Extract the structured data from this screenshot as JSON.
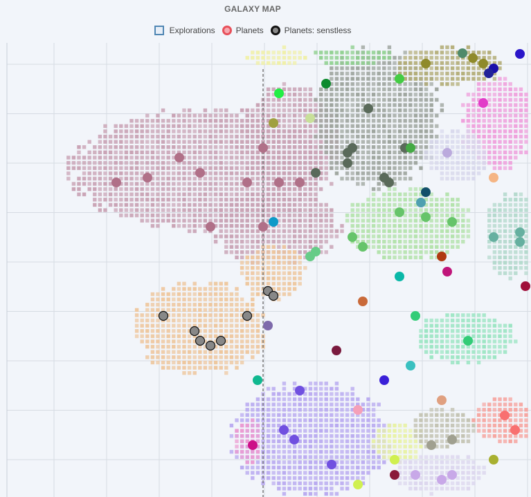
{
  "chart_data": {
    "type": "scatter",
    "title": "GALAXY MAP",
    "xlabel": "",
    "ylabel": "",
    "grid": true,
    "legend_position": "top",
    "series": [
      {
        "name": "Explorations",
        "kind": "square-grid",
        "color": "#4f86b3"
      },
      {
        "name": "Planets",
        "kind": "dot",
        "color": "#e8505a"
      },
      {
        "name": "Planets: senstless",
        "kind": "outlined-dot",
        "color": "#888888"
      }
    ],
    "regions": [
      {
        "color": "#c9a3b5",
        "center": [
          290,
          245
        ],
        "rx": 195,
        "ry": 90
      },
      {
        "color": "#c9a3b5",
        "center": [
          420,
          200
        ],
        "rx": 75,
        "ry": 80
      },
      {
        "color": "#c9a3b5",
        "center": [
          400,
          330
        ],
        "rx": 95,
        "ry": 55
      },
      {
        "color": "#9ea59e",
        "center": [
          545,
          170
        ],
        "rx": 95,
        "ry": 105
      },
      {
        "color": "#b3ad77",
        "center": [
          650,
          95
        ],
        "rx": 85,
        "ry": 30
      },
      {
        "color": "#efa0dc",
        "center": [
          718,
          180
        ],
        "rx": 55,
        "ry": 70
      },
      {
        "color": "#f0f0a8",
        "center": [
          400,
          82
        ],
        "rx": 50,
        "ry": 14
      },
      {
        "color": "#8fd08f",
        "center": [
          510,
          82
        ],
        "rx": 60,
        "ry": 14
      },
      {
        "color": "#d8d8ec",
        "center": [
          660,
          225
        ],
        "rx": 45,
        "ry": 40
      },
      {
        "color": "#b3e2ab",
        "center": [
          590,
          325
        ],
        "rx": 95,
        "ry": 55
      },
      {
        "color": "#b3d9cc",
        "center": [
          740,
          340
        ],
        "rx": 40,
        "ry": 65
      },
      {
        "color": "#eec79e",
        "center": [
          395,
          395
        ],
        "rx": 50,
        "ry": 40
      },
      {
        "color": "#eec79e",
        "center": [
          290,
          475
        ],
        "rx": 100,
        "ry": 70
      },
      {
        "color": "#9be5c3",
        "center": [
          672,
          488
        ],
        "rx": 75,
        "ry": 38
      },
      {
        "color": "#b9aaf0",
        "center": [
          450,
          635
        ],
        "rx": 120,
        "ry": 85
      },
      {
        "color": "#ec9bd1",
        "center": [
          358,
          640
        ],
        "rx": 22,
        "ry": 35
      },
      {
        "color": "#e8f2a5",
        "center": [
          575,
          640
        ],
        "rx": 40,
        "ry": 30
      },
      {
        "color": "#c3c3b3",
        "center": [
          640,
          620
        ],
        "rx": 50,
        "ry": 30
      },
      {
        "color": "#f6a5a0",
        "center": [
          728,
          608
        ],
        "rx": 45,
        "ry": 35
      },
      {
        "color": "#dcd6ee",
        "center": [
          635,
          685
        ],
        "rx": 70,
        "ry": 30
      }
    ],
    "planets": [
      {
        "x": 668,
        "y": 77,
        "color": "#4f8a6a"
      },
      {
        "x": 683,
        "y": 84,
        "color": "#8f8a2a"
      },
      {
        "x": 698,
        "y": 92,
        "color": "#8f8a2a"
      },
      {
        "x": 713,
        "y": 99,
        "color": "#1a0faa"
      },
      {
        "x": 706,
        "y": 106,
        "color": "#222299"
      },
      {
        "x": 751,
        "y": 78,
        "color": "#2a15c9"
      },
      {
        "x": 615,
        "y": 92,
        "color": "#8f8a2a"
      },
      {
        "x": 577,
        "y": 114,
        "color": "#44cc44"
      },
      {
        "x": 471,
        "y": 121,
        "color": "#0d8a2e"
      },
      {
        "x": 403,
        "y": 135,
        "color": "#22ee44"
      },
      {
        "x": 532,
        "y": 157,
        "color": "#5a6a5a"
      },
      {
        "x": 395,
        "y": 178,
        "color": "#a0a040"
      },
      {
        "x": 448,
        "y": 171,
        "color": "#c8e09a"
      },
      {
        "x": 698,
        "y": 149,
        "color": "#e23bc8"
      },
      {
        "x": 380,
        "y": 214,
        "color": "#b07088"
      },
      {
        "x": 259,
        "y": 228,
        "color": "#b07088"
      },
      {
        "x": 289,
        "y": 250,
        "color": "#b07088"
      },
      {
        "x": 213,
        "y": 257,
        "color": "#b07088"
      },
      {
        "x": 168,
        "y": 264,
        "color": "#b07088"
      },
      {
        "x": 357,
        "y": 264,
        "color": "#b07088"
      },
      {
        "x": 403,
        "y": 264,
        "color": "#b07088"
      },
      {
        "x": 433,
        "y": 264,
        "color": "#b07088"
      },
      {
        "x": 456,
        "y": 250,
        "color": "#5a6a5a"
      },
      {
        "x": 502,
        "y": 221,
        "color": "#5a6a5a"
      },
      {
        "x": 509,
        "y": 214,
        "color": "#5a6a5a"
      },
      {
        "x": 502,
        "y": 236,
        "color": "#5a6a5a"
      },
      {
        "x": 585,
        "y": 214,
        "color": "#5a6a5a"
      },
      {
        "x": 593,
        "y": 214,
        "color": "#44aa44"
      },
      {
        "x": 646,
        "y": 221,
        "color": "#bbaadd"
      },
      {
        "x": 555,
        "y": 257,
        "color": "#5a6a5a"
      },
      {
        "x": 562,
        "y": 264,
        "color": "#5a6a5a"
      },
      {
        "x": 713,
        "y": 257,
        "color": "#f5b584"
      },
      {
        "x": 615,
        "y": 278,
        "color": "#124f6a"
      },
      {
        "x": 608,
        "y": 293,
        "color": "#4fa0b0"
      },
      {
        "x": 577,
        "y": 307,
        "color": "#66c46a"
      },
      {
        "x": 615,
        "y": 314,
        "color": "#66c46a"
      },
      {
        "x": 653,
        "y": 321,
        "color": "#66c46a"
      },
      {
        "x": 304,
        "y": 328,
        "color": "#b07088"
      },
      {
        "x": 380,
        "y": 328,
        "color": "#b07088"
      },
      {
        "x": 395,
        "y": 321,
        "color": "#0e9ac8"
      },
      {
        "x": 509,
        "y": 343,
        "color": "#66c46a"
      },
      {
        "x": 524,
        "y": 357,
        "color": "#66c46a"
      },
      {
        "x": 456,
        "y": 364,
        "color": "#66cc88"
      },
      {
        "x": 448,
        "y": 371,
        "color": "#66cc88"
      },
      {
        "x": 713,
        "y": 343,
        "color": "#66b0a0"
      },
      {
        "x": 751,
        "y": 336,
        "color": "#66b0a0"
      },
      {
        "x": 751,
        "y": 350,
        "color": "#66b0a0"
      },
      {
        "x": 638,
        "y": 371,
        "color": "#b03a10"
      },
      {
        "x": 646,
        "y": 393,
        "color": "#c0157a"
      },
      {
        "x": 577,
        "y": 400,
        "color": "#0ab8a8"
      },
      {
        "x": 759,
        "y": 414,
        "color": "#a00f3a"
      },
      {
        "x": 524,
        "y": 436,
        "color": "#c96a3a"
      },
      {
        "x": 600,
        "y": 457,
        "color": "#33cc77"
      },
      {
        "x": 387,
        "y": 471,
        "color": "#7e6aab"
      },
      {
        "x": 676,
        "y": 493,
        "color": "#33cc77"
      },
      {
        "x": 486,
        "y": 507,
        "color": "#7a1a3e"
      },
      {
        "x": 593,
        "y": 529,
        "color": "#3ac0c0"
      },
      {
        "x": 372,
        "y": 550,
        "color": "#10b890"
      },
      {
        "x": 555,
        "y": 550,
        "color": "#3a20d8"
      },
      {
        "x": 433,
        "y": 565,
        "color": "#7050e0"
      },
      {
        "x": 638,
        "y": 579,
        "color": "#e0a080"
      },
      {
        "x": 517,
        "y": 593,
        "color": "#f5a0b8"
      },
      {
        "x": 729,
        "y": 601,
        "color": "#f87070"
      },
      {
        "x": 410,
        "y": 622,
        "color": "#7050e0"
      },
      {
        "x": 425,
        "y": 636,
        "color": "#7050e0"
      },
      {
        "x": 744,
        "y": 622,
        "color": "#f87070"
      },
      {
        "x": 623,
        "y": 644,
        "color": "#a0a090"
      },
      {
        "x": 653,
        "y": 636,
        "color": "#a0a090"
      },
      {
        "x": 365,
        "y": 644,
        "color": "#cc0f88"
      },
      {
        "x": 570,
        "y": 665,
        "color": "#d0f050"
      },
      {
        "x": 713,
        "y": 665,
        "color": "#a8b030"
      },
      {
        "x": 479,
        "y": 672,
        "color": "#7050e0"
      },
      {
        "x": 570,
        "y": 687,
        "color": "#8a1a3a"
      },
      {
        "x": 600,
        "y": 687,
        "color": "#c8a8e8"
      },
      {
        "x": 638,
        "y": 694,
        "color": "#c8a8e8"
      },
      {
        "x": 653,
        "y": 687,
        "color": "#c8a8e8"
      },
      {
        "x": 517,
        "y": 701,
        "color": "#d0f050"
      }
    ],
    "senseless_planets": [
      {
        "x": 387,
        "y": 421
      },
      {
        "x": 395,
        "y": 428
      },
      {
        "x": 236,
        "y": 457
      },
      {
        "x": 357,
        "y": 457
      },
      {
        "x": 281,
        "y": 479
      },
      {
        "x": 289,
        "y": 493
      },
      {
        "x": 304,
        "y": 500
      },
      {
        "x": 319,
        "y": 493
      }
    ],
    "dashed_line_x": 380
  }
}
